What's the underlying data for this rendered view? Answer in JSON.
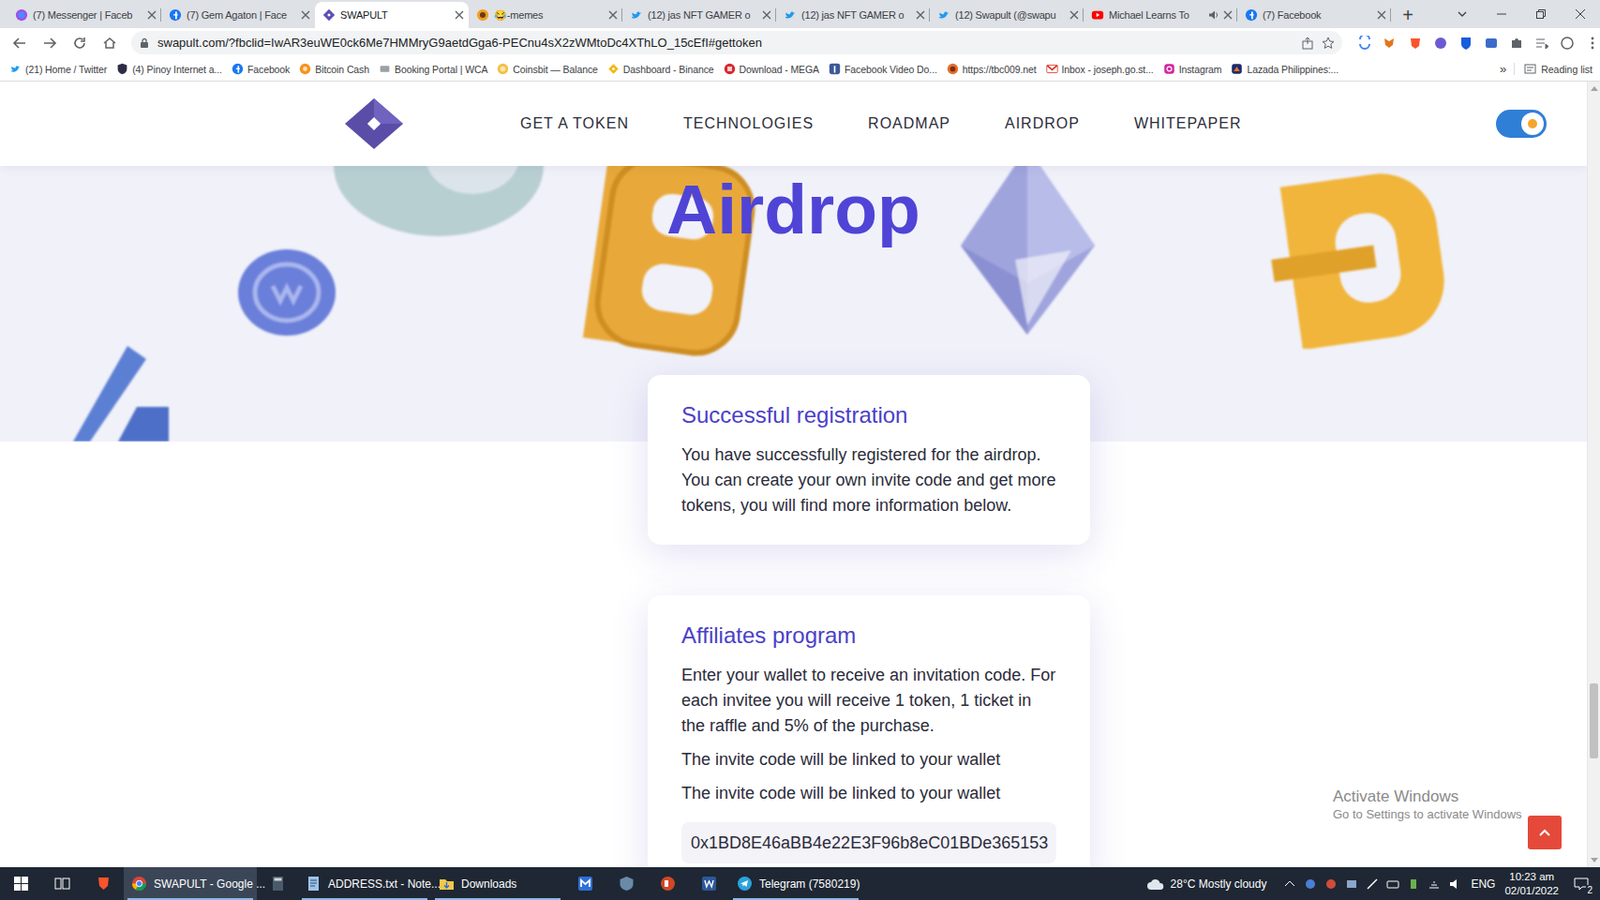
{
  "browser": {
    "tabs": [
      {
        "label": "(7) Messenger | Faceb",
        "selected": false,
        "audio": false,
        "kind": "messenger"
      },
      {
        "label": "(7) Gem Agaton | Face",
        "selected": false,
        "audio": false,
        "kind": "facebook"
      },
      {
        "label": "SWAPULT",
        "selected": true,
        "audio": false,
        "kind": "swapult"
      },
      {
        "label": "😂-memes",
        "selected": false,
        "audio": false,
        "kind": "server"
      },
      {
        "label": "(12) jas NFT GAMER o",
        "selected": false,
        "audio": false,
        "kind": "twitter"
      },
      {
        "label": "(12) jas NFT GAMER o",
        "selected": false,
        "audio": false,
        "kind": "twitter"
      },
      {
        "label": "(12) Swapult (@swapu",
        "selected": false,
        "audio": false,
        "kind": "twitter"
      },
      {
        "label": "Michael Learns To",
        "selected": false,
        "audio": true,
        "kind": "youtube"
      },
      {
        "label": "(7) Facebook",
        "selected": false,
        "audio": false,
        "kind": "facebook"
      }
    ],
    "new_tab": "+",
    "address": "swapult.com/?fbclid=IwAR3euWE0ck6Me7HMMryG9aetdGga6-PECnu4sX2zWMtoDc4XThLO_15cEfI#gettoken",
    "bookmarks": [
      {
        "label": "(21) Home / Twitter",
        "kind": "twitter"
      },
      {
        "label": "(4) Pinoy Internet a...",
        "kind": "shield"
      },
      {
        "label": "Facebook",
        "kind": "facebook"
      },
      {
        "label": "Bitcoin Cash",
        "kind": "bitcoin"
      },
      {
        "label": "Booking Portal | WCA",
        "kind": "booking"
      },
      {
        "label": "Coinsbit — Balance",
        "kind": "coinsbit"
      },
      {
        "label": "Dashboard - Binance",
        "kind": "binance"
      },
      {
        "label": "Download - MEGA",
        "kind": "mega"
      },
      {
        "label": "Facebook Video Do...",
        "kind": "fbvideo"
      },
      {
        "label": "https://tbc009.net",
        "kind": "tbc"
      },
      {
        "label": "Inbox - joseph.go.st...",
        "kind": "gmail"
      },
      {
        "label": "Instagram",
        "kind": "instagram"
      },
      {
        "label": "Lazada Philippines:...",
        "kind": "lazada"
      }
    ],
    "bookmarks_more": "»",
    "reading_list": "Reading list"
  },
  "page": {
    "nav": [
      "GET A TOKEN",
      "TECHNOLOGIES",
      "ROADMAP",
      "AIRDROP",
      "WHITEPAPER"
    ],
    "theme_toggle": {
      "on": true
    },
    "hero_title": "Airdrop",
    "cards": [
      {
        "title": "Successful registration",
        "paragraphs": [
          "You have successfully registered for the airdrop. You can create your own invite code and get more tokens, you will find more information below."
        ]
      },
      {
        "title": "Affiliates program",
        "paragraphs": [
          "Enter your wallet to receive an invitation code. For each invitee you will receive 1 token, 1 ticket in the raffle and 5% of the purchase.",
          "The invite code will be linked to your wallet",
          "The invite code will be linked to your wallet"
        ],
        "field_value": "0x1BD8E46aBB4e22E3F96b8eC01BDe365153"
      }
    ],
    "scroll_level": 0.86
  },
  "watermark": {
    "title": "Activate Windows",
    "subtitle": "Go to Settings to activate Windows"
  },
  "taskbar": {
    "apps": [
      {
        "kind": "start",
        "active": false
      },
      {
        "kind": "taskview",
        "active": false
      },
      {
        "kind": "brave",
        "active": false
      },
      {
        "kind": "chrome",
        "label": "SWAPULT - Google ...",
        "active": true
      },
      {
        "kind": "calculator",
        "active": false
      },
      {
        "kind": "notepad",
        "label": "ADDRESS.txt - Note...",
        "active": false
      },
      {
        "kind": "downloads",
        "label": "Downloads",
        "active": false
      },
      {
        "kind": "mtool",
        "active": false
      },
      {
        "kind": "shield",
        "active": false
      },
      {
        "kind": "powerpoint",
        "active": false
      },
      {
        "kind": "word",
        "active": false
      },
      {
        "kind": "telegram",
        "label": "Telegram (7580219)",
        "active": false
      }
    ],
    "weather": "28°C Mostly cloudy",
    "language": "ENG",
    "time": "10:23 am",
    "date": "02/01/2022",
    "notifications": "2"
  }
}
